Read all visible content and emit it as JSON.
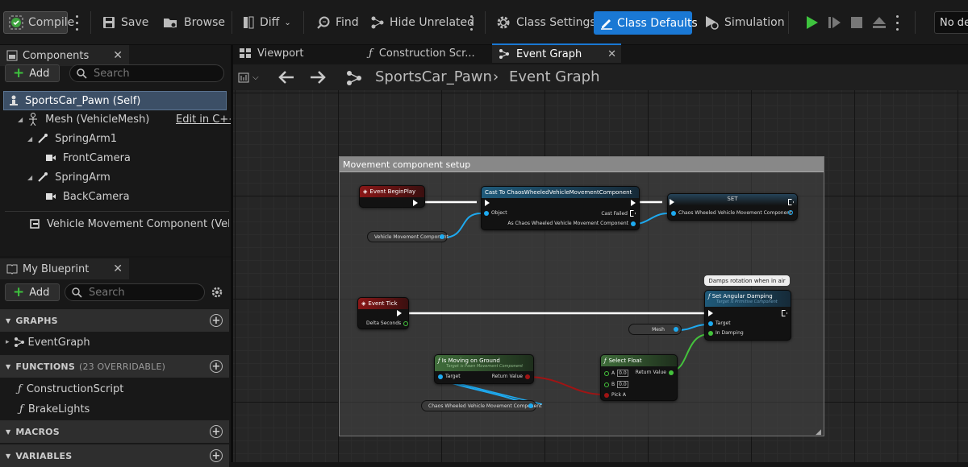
{
  "toolbar": {
    "compile": "Compile",
    "save": "Save",
    "browse": "Browse",
    "diff": "Diff",
    "find": "Find",
    "hide_unrelated": "Hide Unrelated",
    "class_settings": "Class Settings",
    "class_defaults": "Class Defaults",
    "simulation": "Simulation",
    "debug_filter": "No de"
  },
  "components": {
    "title": "Components",
    "add": "Add",
    "search_placeholder": "Search",
    "items": [
      {
        "label": "SportsCar_Pawn (Self)"
      },
      {
        "label": "Mesh (VehicleMesh)",
        "extra": "Edit in C++"
      },
      {
        "label": "SpringArm1"
      },
      {
        "label": "FrontCamera"
      },
      {
        "label": "SpringArm"
      },
      {
        "label": "BackCamera"
      },
      {
        "label": "Vehicle Movement Component (VehicleM"
      }
    ]
  },
  "my_blueprint": {
    "title": "My Blueprint",
    "add": "Add",
    "search_placeholder": "Search",
    "graphs_header": "GRAPHS",
    "graphs": [
      "EventGraph"
    ],
    "functions_header": "FUNCTIONS",
    "functions_count": "(23 OVERRIDABLE)",
    "functions": [
      "ConstructionScript",
      "BrakeLights"
    ],
    "macros_header": "MACROS",
    "variables_header": "VARIABLES"
  },
  "tabs": [
    "Viewport",
    "Construction Scr...",
    "Event Graph"
  ],
  "breadcrumb": {
    "asset": "SportsCar_Pawn",
    "graph": "Event Graph"
  },
  "graph": {
    "comment": "Movement component setup",
    "event_beginplay": "Event BeginPlay",
    "cast_title": "Cast To ChaosWheeledVehicleMovementComponent",
    "cast_object": "Object",
    "cast_failed": "Cast Failed",
    "cast_as": "As Chaos Wheeled Vehicle Movement Component",
    "set_title": "SET",
    "set_pin": "Chaos Wheeled Vehicle Movement Component",
    "vmc_var": "Vehicle Movement Component",
    "event_tick": "Event Tick",
    "delta_seconds": "Delta Seconds",
    "mesh_var": "Mesh",
    "set_ang_title": "Set Angular Damping",
    "set_ang_sub": "Target is Primitive Component",
    "target": "Target",
    "in_damping": "In Damping",
    "damp_comment": "Damps rotation when in air",
    "moving_title": "Is Moving on Ground",
    "moving_sub": "Target is Pawn Movement Component",
    "return_value": "Return Value",
    "select_title": "Select Float",
    "sel_a": "A",
    "sel_b": "B",
    "sel_a_val": "0.0",
    "sel_b_val": "0.0",
    "pick_a": "Pick A",
    "cwvmc_var": "Chaos Wheeled Vehicle Movement Component"
  }
}
